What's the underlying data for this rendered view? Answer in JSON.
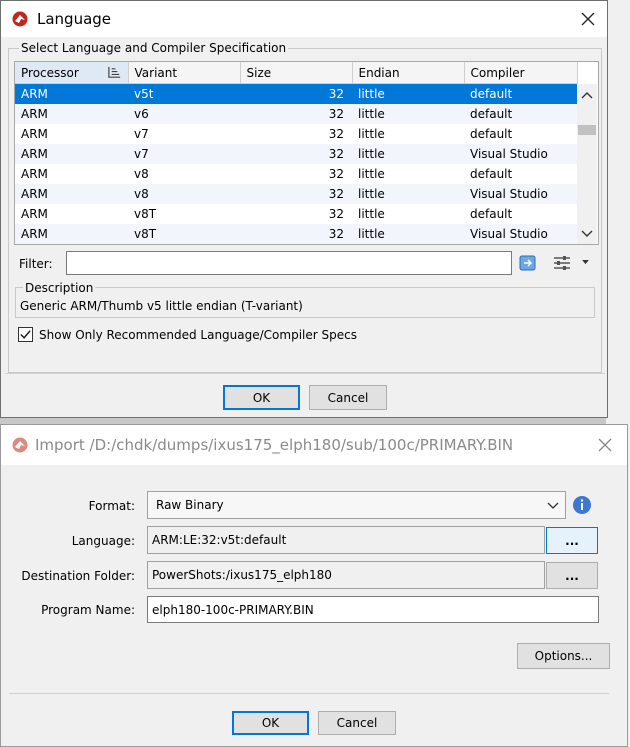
{
  "language_dialog": {
    "title": "Language",
    "section_label": "Select Language and Compiler Specification",
    "columns": [
      "Processor",
      "Variant",
      "Size",
      "Endian",
      "Compiler"
    ],
    "rows": [
      [
        "ARM",
        "v5t",
        "32",
        "little",
        "default"
      ],
      [
        "ARM",
        "v6",
        "32",
        "little",
        "default"
      ],
      [
        "ARM",
        "v7",
        "32",
        "little",
        "default"
      ],
      [
        "ARM",
        "v7",
        "32",
        "little",
        "Visual Studio"
      ],
      [
        "ARM",
        "v8",
        "32",
        "little",
        "default"
      ],
      [
        "ARM",
        "v8",
        "32",
        "little",
        "Visual Studio"
      ],
      [
        "ARM",
        "v8T",
        "32",
        "little",
        "default"
      ],
      [
        "ARM",
        "v8T",
        "32",
        "little",
        "Visual Studio"
      ]
    ],
    "selected_row": 0,
    "filter_label": "Filter:",
    "filter_value": "",
    "description_label": "Description",
    "description_text": "Generic ARM/Thumb v5 little endian (T-variant)",
    "recommended_checkbox_label": "Show Only Recommended Language/Compiler Specs",
    "recommended_checked": true,
    "ok_label": "OK",
    "cancel_label": "Cancel"
  },
  "import_dialog": {
    "title": "Import /D:/chdk/dumps/ixus175_elph180/sub/100c/PRIMARY.BIN",
    "format_label": "Format:",
    "format_value": "Raw Binary",
    "language_label": "Language:",
    "language_value": "ARM:LE:32:v5t:default",
    "language_button": "...",
    "destination_label": "Destination Folder:",
    "destination_value": "PowerShots:/ixus175_elph180",
    "destination_button": "...",
    "program_name_label": "Program Name:",
    "program_name_value": "elph180-100c-PRIMARY.BIN",
    "options_label": "Options...",
    "ok_label": "OK",
    "cancel_label": "Cancel"
  },
  "colors": {
    "selection": "#0078d7",
    "alt_row": "#f2f6fc",
    "app_icon": "#c0281e"
  }
}
